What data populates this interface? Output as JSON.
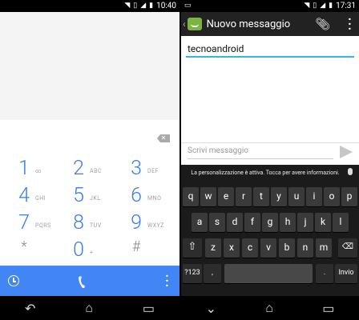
{
  "left_screen": {
    "status_time": "10:40",
    "keys": [
      {
        "num": "1",
        "letters": "∞"
      },
      {
        "num": "2",
        "letters": "ABC"
      },
      {
        "num": "3",
        "letters": "DEF"
      },
      {
        "num": "4",
        "letters": "GHI"
      },
      {
        "num": "5",
        "letters": "JKL"
      },
      {
        "num": "6",
        "letters": "MNO"
      },
      {
        "num": "7",
        "letters": "PQRS"
      },
      {
        "num": "8",
        "letters": "TUV"
      },
      {
        "num": "9",
        "letters": "WXYZ"
      },
      {
        "num": "*",
        "letters": ""
      },
      {
        "num": "0",
        "letters": "+"
      },
      {
        "num": "#",
        "letters": ""
      }
    ],
    "icons": {
      "history": "clock-icon",
      "call": "phone-icon",
      "menu": "overflow-menu-icon",
      "backspace": "backspace-icon"
    },
    "accent": "#4285f4"
  },
  "right_screen": {
    "status_time": "17:31",
    "title": "Nuovo messaggio",
    "recipient": "tecnoandroid",
    "compose_placeholder": "Scrivi messaggio",
    "keyboard_hint": "La personalizzazione è attiva. Tocca per avere informazioni.",
    "rows": [
      [
        "q",
        "w",
        "e",
        "r",
        "t",
        "y",
        "u",
        "i",
        "o",
        "p"
      ],
      [
        "a",
        "s",
        "d",
        "f",
        "g",
        "h",
        "j",
        "k",
        "l"
      ],
      [
        "z",
        "x",
        "c",
        "v",
        "b",
        "n",
        "m"
      ]
    ],
    "key_123": "?123",
    "key_enter": "Invio",
    "key_comma": ",",
    "key_period": "."
  }
}
